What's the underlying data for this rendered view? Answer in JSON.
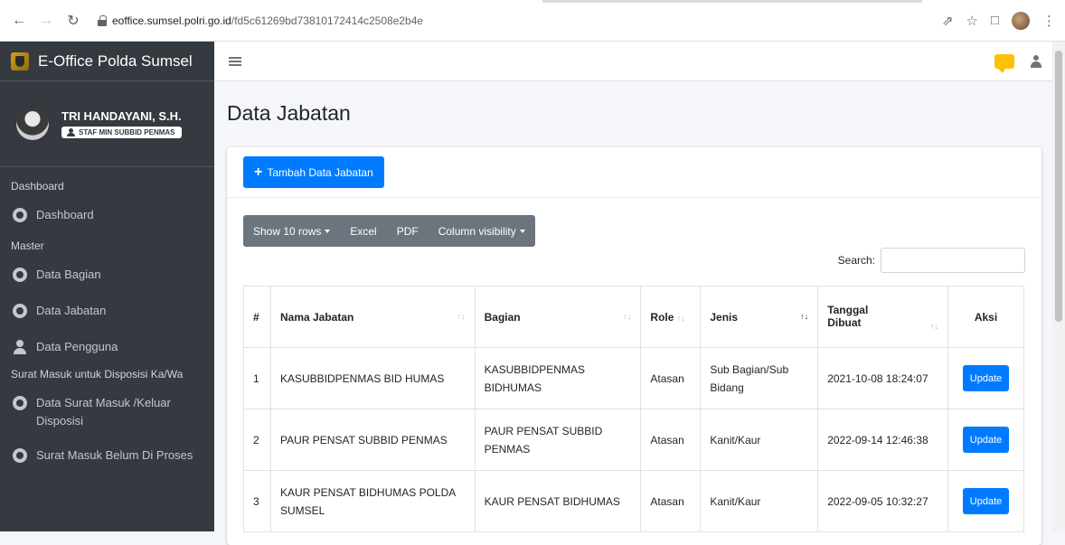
{
  "browser": {
    "url_host": "eoffice.sumsel.polri.go.id",
    "url_path": "/fd5c61269bd73810172414c2508e2b4e"
  },
  "sidebar": {
    "brand": "E-Office Polda Sumsel",
    "user_name": "TRI HANDAYANI, S.H.",
    "user_role": "STAF MIN SUBBID PENMAS",
    "sections": [
      {
        "header": "Dashboard",
        "items": [
          {
            "label": "Dashboard",
            "icon": "palette-icon"
          }
        ]
      },
      {
        "header": "Master",
        "items": [
          {
            "label": "Data Bagian",
            "icon": "palette-icon"
          },
          {
            "label": "Data Jabatan",
            "icon": "palette-icon"
          },
          {
            "label": "Data Pengguna",
            "icon": "user-icon"
          }
        ]
      },
      {
        "header": "Surat Masuk untuk Disposisi Ka/Wa",
        "items": [
          {
            "label": "Data Surat Masuk /Keluar Disposisi",
            "icon": "palette-icon"
          },
          {
            "label": "Surat Masuk Belum Di Proses",
            "icon": "palette-icon"
          }
        ]
      }
    ]
  },
  "main": {
    "title": "Data Jabatan",
    "add_button": "Tambah Data Jabatan",
    "toolbar": {
      "show_rows": "Show 10 rows",
      "excel": "Excel",
      "pdf": "PDF",
      "column_visibility": "Column visibility"
    },
    "search_label": "Search:",
    "search_value": "",
    "table": {
      "headers": [
        "#",
        "Nama Jabatan",
        "Bagian",
        "Role",
        "Jenis",
        "Tanggal Dibuat",
        "Aksi"
      ],
      "rows": [
        {
          "num": "1",
          "nama": "KASUBBIDPENMAS BID HUMAS",
          "bagian": "KASUBBIDPENMAS BIDHUMAS",
          "role": "Atasan",
          "jenis": "Sub Bagian/Sub Bidang",
          "tanggal": "2021-10-08 18:24:07",
          "aksi": "Update"
        },
        {
          "num": "2",
          "nama": "PAUR PENSAT SUBBID PENMAS",
          "bagian": "PAUR PENSAT SUBBID PENMAS",
          "role": "Atasan",
          "jenis": "Kanit/Kaur",
          "tanggal": "2022-09-14 12:46:38",
          "aksi": "Update"
        },
        {
          "num": "3",
          "nama": "KAUR PENSAT BIDHUMAS POLDA SUMSEL",
          "bagian": "KAUR PENSAT BIDHUMAS",
          "role": "Atasan",
          "jenis": "Kanit/Kaur",
          "tanggal": "2022-09-05 10:32:27",
          "aksi": "Update"
        }
      ]
    }
  },
  "colors": {
    "primary": "#007bff",
    "sidebar_bg": "#343a40",
    "secondary": "#6c757d",
    "warning": "#ffc107"
  }
}
